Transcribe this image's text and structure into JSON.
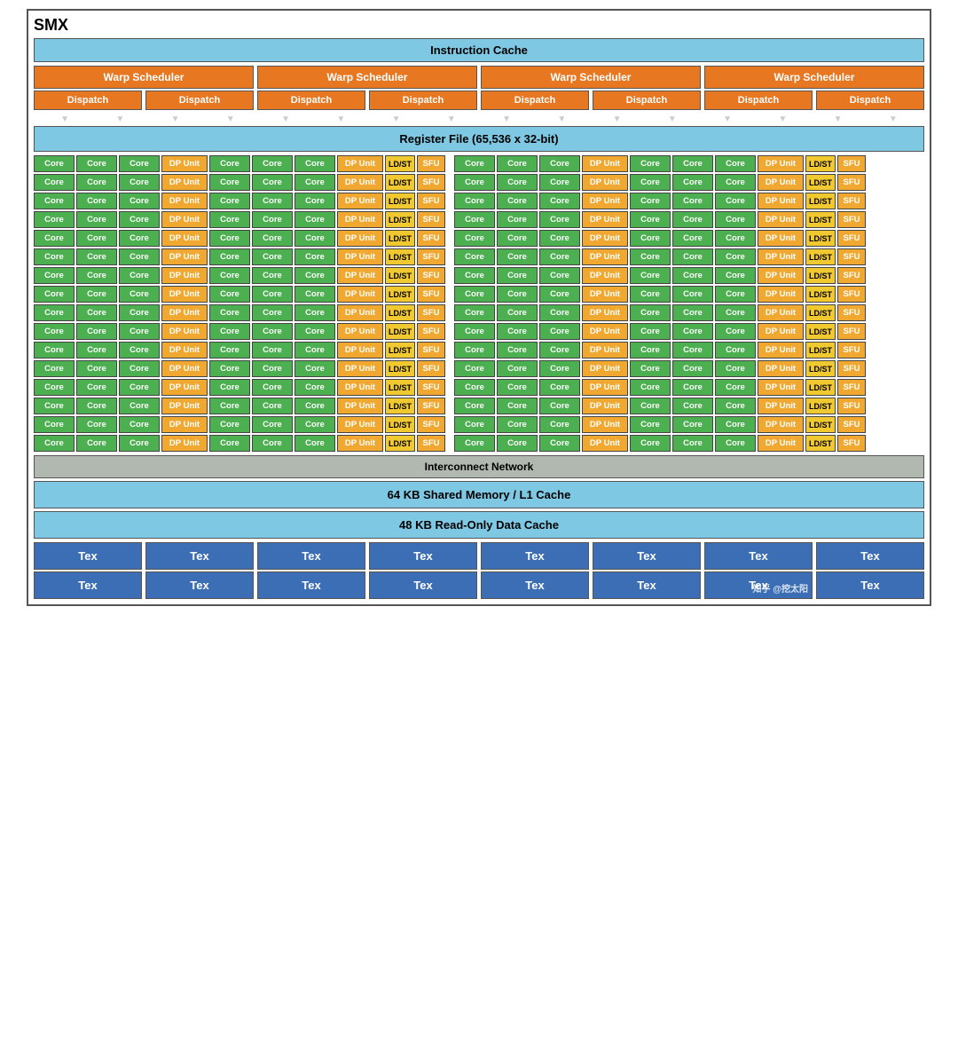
{
  "title": "SMX",
  "instruction_cache": "Instruction Cache",
  "warp_schedulers": [
    "Warp Scheduler",
    "Warp Scheduler",
    "Warp Scheduler",
    "Warp Scheduler"
  ],
  "dispatch_units": [
    "Dispatch",
    "Dispatch",
    "Dispatch",
    "Dispatch",
    "Dispatch",
    "Dispatch",
    "Dispatch",
    "Dispatch"
  ],
  "register_file": "Register File (65,536 x 32-bit)",
  "interconnect": "Interconnect Network",
  "shared_mem": "64 KB Shared Memory / L1 Cache",
  "readonly_cache": "48 KB Read-Only Data Cache",
  "tex_labels": [
    "Tex",
    "Tex",
    "Tex",
    "Tex",
    "Tex",
    "Tex",
    "Tex",
    "Tex"
  ],
  "tex_labels2": [
    "Tex",
    "Tex",
    "Tex",
    "Tex",
    "Tex",
    "Tex",
    "T知乎 @挖太阳"
  ],
  "watermark": "知乎 @挖太阳"
}
